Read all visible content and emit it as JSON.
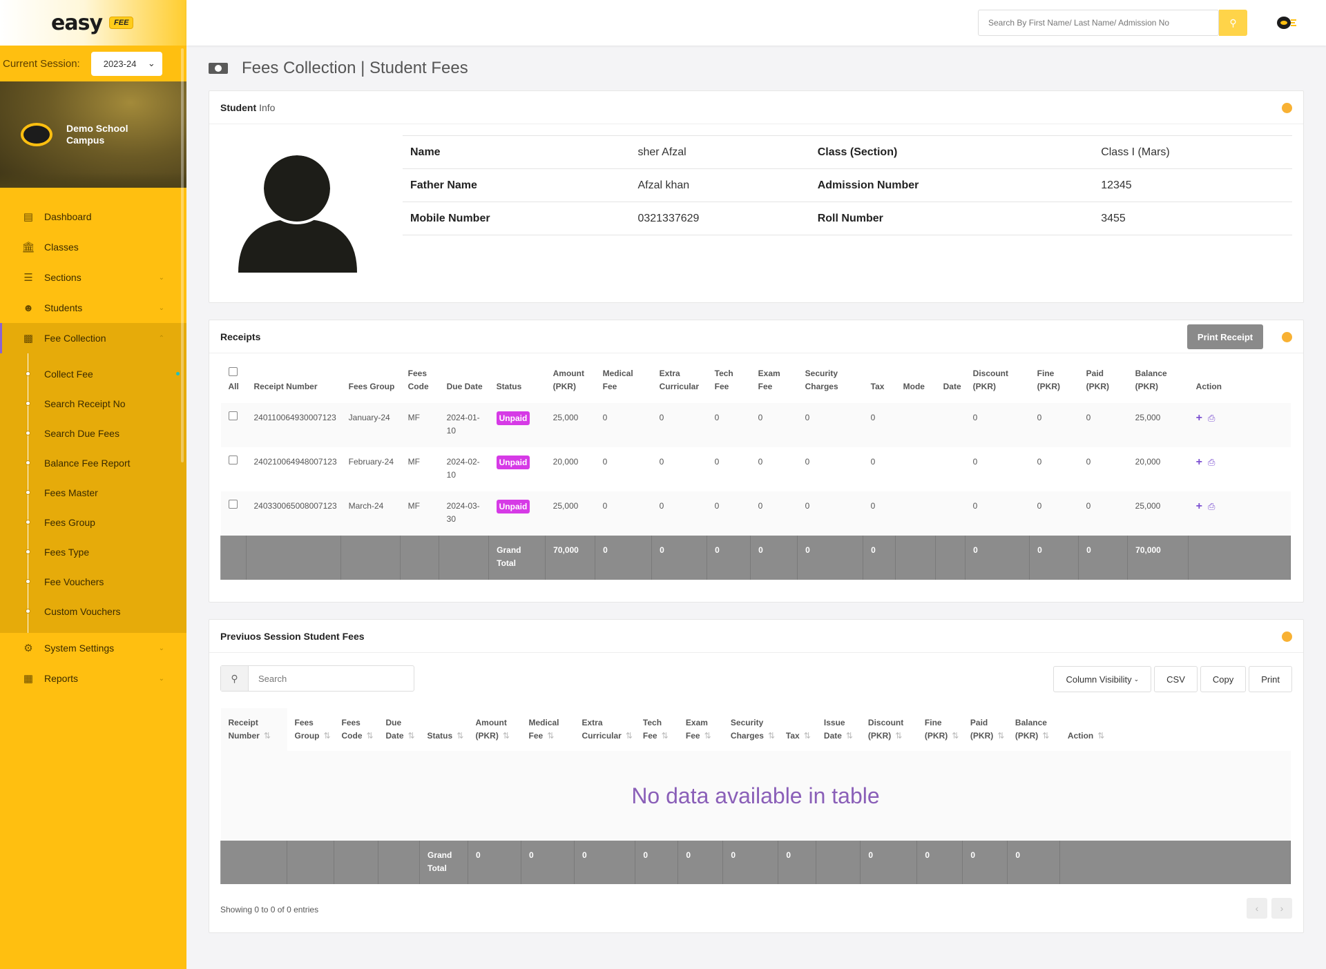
{
  "brand": {
    "logo_text": "easy",
    "badge": "FEE"
  },
  "session": {
    "label": "Current Session:",
    "value": "2023-24"
  },
  "campus": {
    "name": "Demo School Campus"
  },
  "nav": {
    "items": [
      {
        "label": "Dashboard"
      },
      {
        "label": "Classes"
      },
      {
        "label": "Sections"
      },
      {
        "label": "Students"
      },
      {
        "label": "Fee Collection"
      }
    ],
    "sub_items": [
      {
        "label": "Collect Fee"
      },
      {
        "label": "Search Receipt No"
      },
      {
        "label": "Search Due Fees"
      },
      {
        "label": "Balance Fee Report"
      },
      {
        "label": "Fees Master"
      },
      {
        "label": "Fees Group"
      },
      {
        "label": "Fees Type"
      },
      {
        "label": "Fee Vouchers"
      },
      {
        "label": "Custom Vouchers"
      }
    ],
    "bottom_items": [
      {
        "label": "System Settings"
      },
      {
        "label": "Reports"
      }
    ]
  },
  "topbar": {
    "search_placeholder": "Search By First Name/ Last Name/ Admission No"
  },
  "page": {
    "title": "Fees Collection | Student Fees"
  },
  "student_info": {
    "title_bold": "Student",
    "title_light": "Info",
    "name_label": "Name",
    "name": "sher Afzal",
    "class_label": "Class (Section)",
    "class": "Class I (Mars)",
    "father_label": "Father Name",
    "father": "Afzal khan",
    "admission_label": "Admission Number",
    "admission": "12345",
    "mobile_label": "Mobile Number",
    "mobile": "0321337629",
    "roll_label": "Roll Number",
    "roll": "3455"
  },
  "receipts": {
    "title": "Receipts",
    "print_label": "Print Receipt",
    "headers": {
      "all": "All",
      "receipt": "Receipt Number",
      "group": "Fees Group",
      "code": "Fees Code",
      "due": "Due Date",
      "status": "Status",
      "amount": "Amount (PKR)",
      "medical": "Medical Fee",
      "extra": "Extra Curricular",
      "tech": "Tech Fee",
      "exam": "Exam Fee",
      "security": "Security Charges",
      "tax": "Tax",
      "mode": "Mode",
      "date": "Date",
      "discount": "Discount (PKR)",
      "fine": "Fine (PKR)",
      "paid": "Paid (PKR)",
      "balance": "Balance (PKR)",
      "action": "Action"
    },
    "rows": [
      {
        "receipt": "240110064930007123",
        "group": "January-24",
        "code": "MF",
        "due": "2024-01-10",
        "status": "Unpaid",
        "amount": "25,000",
        "medical": "0",
        "extra": "0",
        "tech": "0",
        "exam": "0",
        "security": "0",
        "tax": "0",
        "mode": "",
        "date": "",
        "discount": "0",
        "fine": "0",
        "paid": "0",
        "balance": "25,000"
      },
      {
        "receipt": "240210064948007123",
        "group": "February-24",
        "code": "MF",
        "due": "2024-02-10",
        "status": "Unpaid",
        "amount": "20,000",
        "medical": "0",
        "extra": "0",
        "tech": "0",
        "exam": "0",
        "security": "0",
        "tax": "0",
        "mode": "",
        "date": "",
        "discount": "0",
        "fine": "0",
        "paid": "0",
        "balance": "20,000"
      },
      {
        "receipt": "240330065008007123",
        "group": "March-24",
        "code": "MF",
        "due": "2024-03-30",
        "status": "Unpaid",
        "amount": "25,000",
        "medical": "0",
        "extra": "0",
        "tech": "0",
        "exam": "0",
        "security": "0",
        "tax": "0",
        "mode": "",
        "date": "",
        "discount": "0",
        "fine": "0",
        "paid": "0",
        "balance": "25,000"
      }
    ],
    "totals": {
      "label": "Grand Total",
      "amount": "70,000",
      "medical": "0",
      "extra": "0",
      "tech": "0",
      "exam": "0",
      "security": "0",
      "tax": "0",
      "discount": "0",
      "fine": "0",
      "paid": "0",
      "balance": "70,000"
    }
  },
  "previous": {
    "title": "Previuos Session Student Fees",
    "search_placeholder": "Search",
    "buttons": {
      "visibility": "Column Visibility",
      "csv": "CSV",
      "copy": "Copy",
      "print": "Print"
    },
    "headers": {
      "receipt": "Receipt Number",
      "group": "Fees Group",
      "code": "Fees Code",
      "due": "Due Date",
      "status": "Status",
      "amount": "Amount (PKR)",
      "medical": "Medical Fee",
      "extra": "Extra Curricular",
      "tech": "Tech Fee",
      "exam": "Exam Fee",
      "security": "Security Charges",
      "tax": "Tax",
      "issue": "Issue Date",
      "discount": "Discount (PKR)",
      "fine": "Fine (PKR)",
      "paid": "Paid (PKR)",
      "balance": "Balance (PKR)",
      "action": "Action"
    },
    "empty": "No data available in table",
    "totals": {
      "label": "Grand Total",
      "amount": "0",
      "medical": "0",
      "extra": "0",
      "tech": "0",
      "exam": "0",
      "security": "0",
      "tax": "0",
      "discount": "0",
      "fine": "0",
      "paid": "0",
      "balance": "0"
    },
    "showing": "Showing 0 to 0 of 0 entries"
  }
}
